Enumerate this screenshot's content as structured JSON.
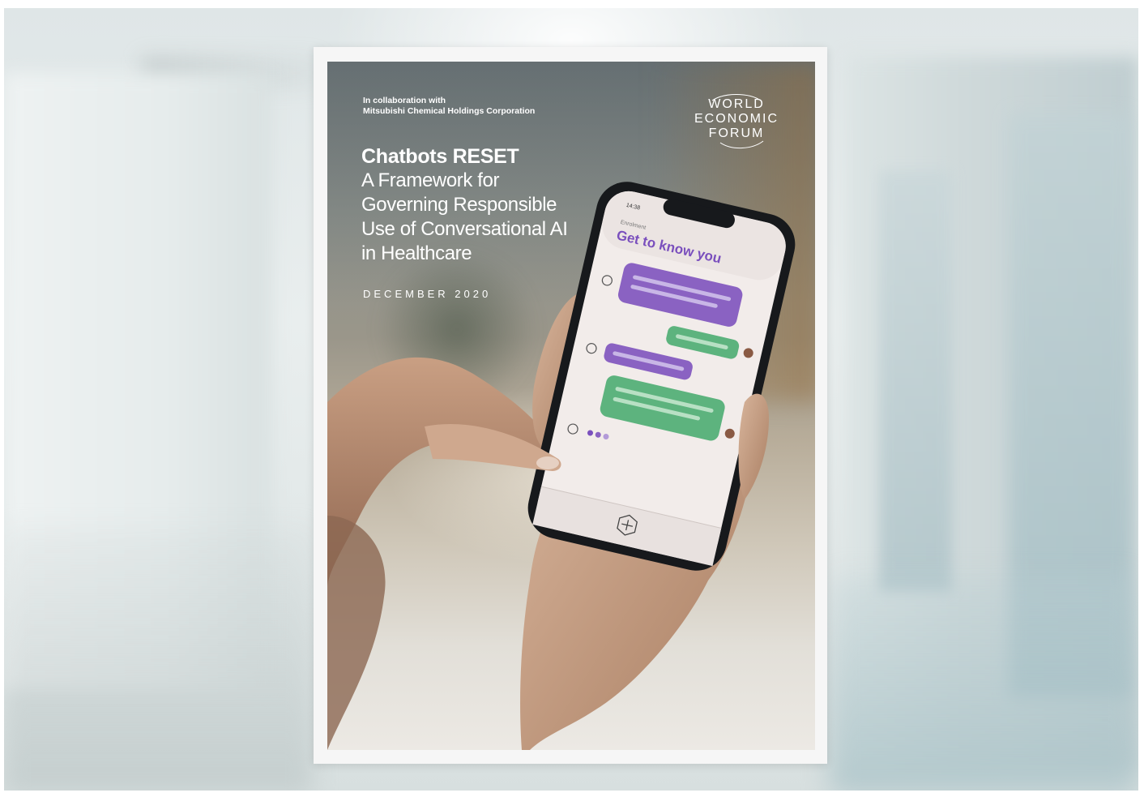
{
  "collaboration": {
    "line1": "In collaboration with",
    "line2": "Mitsubishi Chemical Holdings Corporation"
  },
  "logo": {
    "line1": "WORLD",
    "line2": "ECONOMIC",
    "line3": "FORUM"
  },
  "title": {
    "main": "Chatbots RESET",
    "line1": "A Framework for",
    "line2": "Governing Responsible",
    "line3": "Use of Conversational AI",
    "line4": "in Healthcare"
  },
  "date": "DECEMBER 2020",
  "phone": {
    "time": "14:38",
    "section_label": "Enrolment",
    "heading": "Get to know you"
  },
  "colors": {
    "bot_bubble": "#8a62c2",
    "user_bubble": "#5db37e",
    "heading_text": "#7a4fbd"
  }
}
